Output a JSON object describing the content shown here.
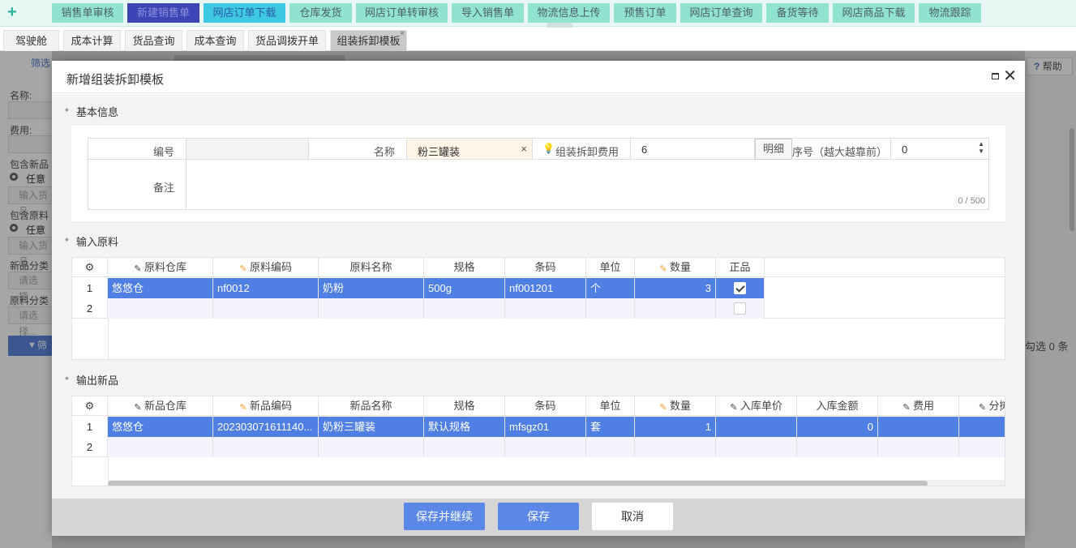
{
  "topnav": {
    "items": [
      {
        "label": "销售单审核",
        "state": "normal"
      },
      {
        "label": "新建销售单",
        "state": "active"
      },
      {
        "label": "网店订单下载",
        "state": "highlight"
      },
      {
        "label": "仓库发货",
        "state": "normal"
      },
      {
        "label": "网店订单转审核",
        "state": "normal"
      },
      {
        "label": "导入销售单",
        "state": "normal"
      },
      {
        "label": "物流信息上传",
        "state": "normal"
      },
      {
        "label": "预售订单",
        "state": "normal"
      },
      {
        "label": "网店订单查询",
        "state": "normal"
      },
      {
        "label": "备货等待",
        "state": "normal"
      },
      {
        "label": "网店商品下载",
        "state": "normal"
      },
      {
        "label": "物流跟踪",
        "state": "normal"
      }
    ]
  },
  "tabs": {
    "items": [
      {
        "label": "驾驶舱"
      },
      {
        "label": "成本计算"
      },
      {
        "label": "货品查询"
      },
      {
        "label": "成本查询"
      },
      {
        "label": "货品调拨开单"
      },
      {
        "label": "组装拆卸模板"
      }
    ],
    "close": "×"
  },
  "background": {
    "filter_title": "筛选",
    "name_label": "名称:",
    "fee_label": "费用:",
    "contains_new_label": "包含新品",
    "radio_any_1": "任意一",
    "goods_placeholder_1": "输入货品",
    "contains_raw_label": "包含原料",
    "radio_any_2": "任意一",
    "goods_placeholder_2": "输入货品",
    "new_category_label": "新品分类",
    "select_placeholder_1": "请选择...",
    "raw_category_label": "原料分类",
    "select_placeholder_2": "请选择...",
    "filter_button": "筛选",
    "help_label": "帮助",
    "selected_count": "勾选 0 条"
  },
  "modal": {
    "title": "新增组装拆卸模板",
    "basic_section": "基本信息",
    "fields": {
      "code_label": "编号",
      "code_value": "",
      "name_label": "名称",
      "name_value": "粉三罐装",
      "fee_label": "组装拆卸费用",
      "fee_value": "6",
      "detail_button": "明细",
      "order_label": "序号（越大越靠前）",
      "order_value": "0",
      "remark_label": "备注",
      "remark_value": "",
      "remark_counter": "0 / 500"
    },
    "input_section": "输入原料",
    "input_grid": {
      "columns": [
        "原料仓库",
        "原料编码",
        "原料名称",
        "规格",
        "条码",
        "单位",
        "数量",
        "正品"
      ],
      "rows": [
        {
          "no": "1",
          "warehouse": "悠悠仓",
          "code": "nf0012",
          "name": "奶粉",
          "spec": "500g",
          "barcode": "nf001201",
          "unit": "个",
          "qty": "3",
          "genuine": true
        },
        {
          "no": "2",
          "warehouse": "",
          "code": "",
          "name": "",
          "spec": "",
          "barcode": "",
          "unit": "",
          "qty": "",
          "genuine": false
        }
      ]
    },
    "output_section": "输出新品",
    "output_grid": {
      "columns": [
        "新品仓库",
        "新品编码",
        "新品名称",
        "规格",
        "条码",
        "单位",
        "数量",
        "入库单价",
        "入库金额",
        "费用",
        "分摊比"
      ],
      "rows": [
        {
          "no": "1",
          "warehouse": "悠悠仓",
          "code": "202303071611140...",
          "name": "奶粉三罐装",
          "spec": "默认规格",
          "barcode": "mfsgz01",
          "unit": "套",
          "qty": "1",
          "price": "",
          "amount": "0",
          "fee": "",
          "ratio": ""
        },
        {
          "no": "2",
          "warehouse": "",
          "code": "",
          "name": "",
          "spec": "",
          "barcode": "",
          "unit": "",
          "qty": "",
          "price": "",
          "amount": "",
          "fee": "",
          "ratio": ""
        }
      ]
    },
    "buttons": {
      "save_continue": "保存并继续",
      "save": "保存",
      "cancel": "取消"
    }
  }
}
